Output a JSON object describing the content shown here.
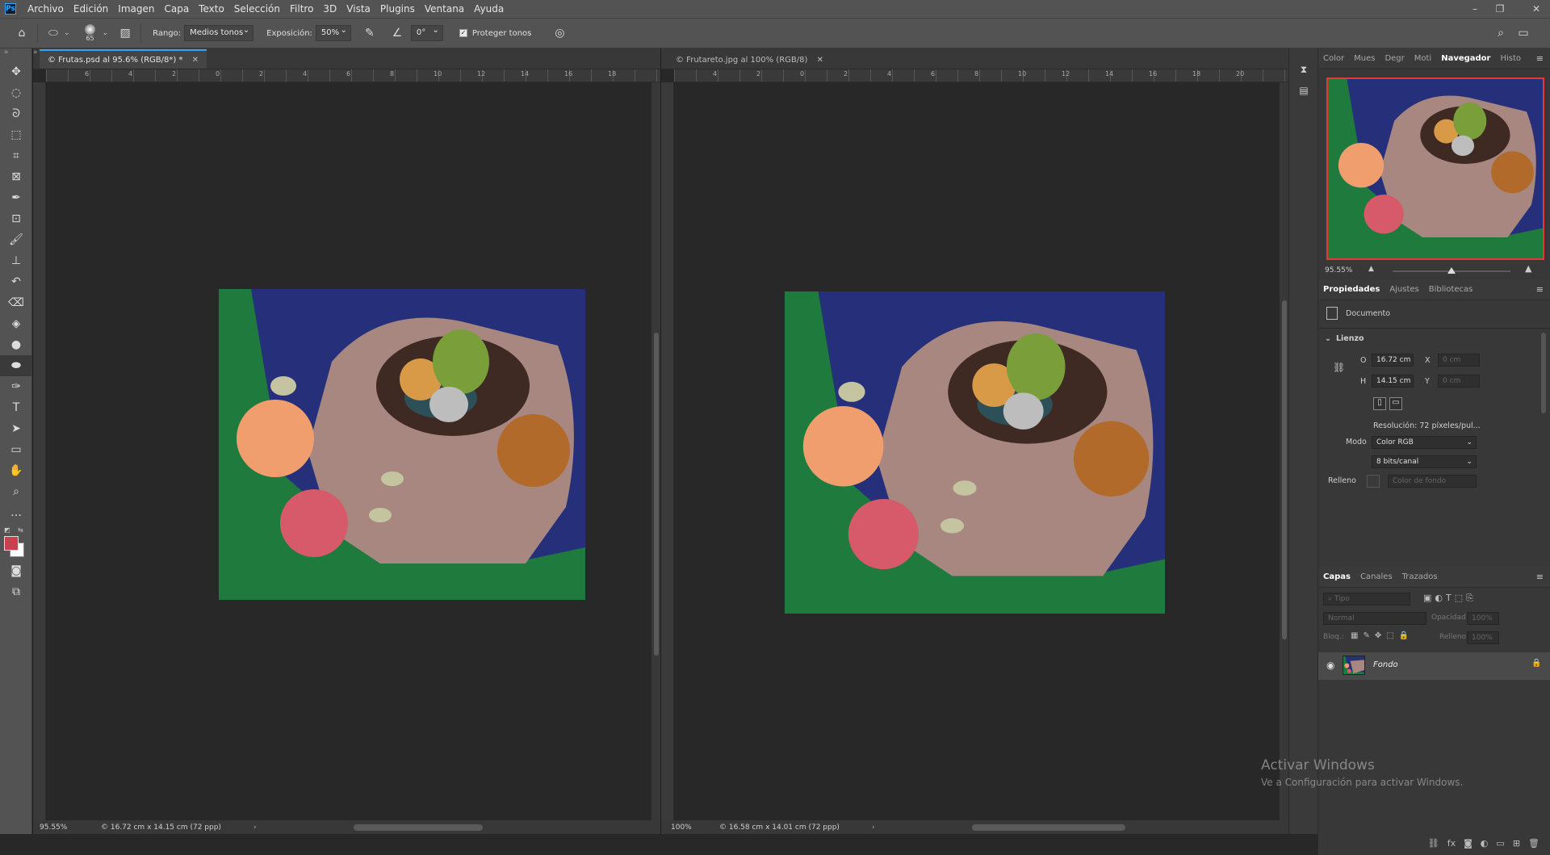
{
  "menu": {
    "logo": "Ps",
    "items": [
      "Archivo",
      "Edición",
      "Imagen",
      "Capa",
      "Texto",
      "Selección",
      "Filtro",
      "3D",
      "Vista",
      "Plugins",
      "Ventana",
      "Ayuda"
    ]
  },
  "options_bar": {
    "brush_size": "65",
    "range_label": "Rango:",
    "range_value": "Medios tonos",
    "exposure_label": "Exposición:",
    "exposure_value": "50%",
    "angle_value": "0°",
    "protect_label": "Proteger tonos"
  },
  "doc1": {
    "tab_title": "© Frutas.psd al 95.6% (RGB/8*) *",
    "zoom": "95.55%",
    "size_info": "© 16.72 cm x 14.15 cm (72 ppp)",
    "ruler_labels": [
      "6",
      "4",
      "2",
      "0",
      "2",
      "4",
      "6",
      "8",
      "10",
      "12",
      "14",
      "16",
      "18"
    ]
  },
  "doc2": {
    "tab_title": "© Frutareto.jpg al 100% (RGB/8)",
    "zoom": "100%",
    "size_info": "© 16.58 cm x 14.01 cm (72 ppp)",
    "ruler_labels": [
      "4",
      "2",
      "0",
      "2",
      "4",
      "6",
      "8",
      "10",
      "12",
      "14",
      "16",
      "18",
      "20"
    ]
  },
  "right_panel": {
    "top_tabs": [
      "Color",
      "Mues",
      "Degr",
      "Moti",
      "Navegador",
      "Histo"
    ],
    "active_top_tab": "Navegador",
    "nav_zoom": "95.55%",
    "prop_tabs": [
      "Propiedades",
      "Ajustes",
      "Bibliotecas"
    ],
    "document_label": "Documento",
    "canvas_section": "Lienzo",
    "width_label": "O",
    "width_value": "16.72 cm",
    "height_label": "H",
    "height_value": "14.15 cm",
    "x_label": "X",
    "x_value": "0 cm",
    "y_label": "Y",
    "y_value": "0 cm",
    "resolution": "Resolución:  72 píxeles/pul...",
    "mode_label": "Modo",
    "mode_value": "Color RGB",
    "bits_value": "8 bits/canal",
    "fill_label": "Relleno",
    "fill_value": "Color de fondo",
    "layer_tabs": [
      "Capas",
      "Canales",
      "Trazados"
    ],
    "filter_placeholder": "Tipo",
    "blend_mode": "Normal",
    "opacity_label": "Opacidad:",
    "opacity_value": "100%",
    "lock_label": "Bloq.:",
    "fill2_label": "Relleno:",
    "fill2_value": "100%",
    "layer_name": "Fondo"
  },
  "watermark": {
    "line1": "Activar Windows",
    "line2": "Ve a Configuración para activar Windows."
  }
}
